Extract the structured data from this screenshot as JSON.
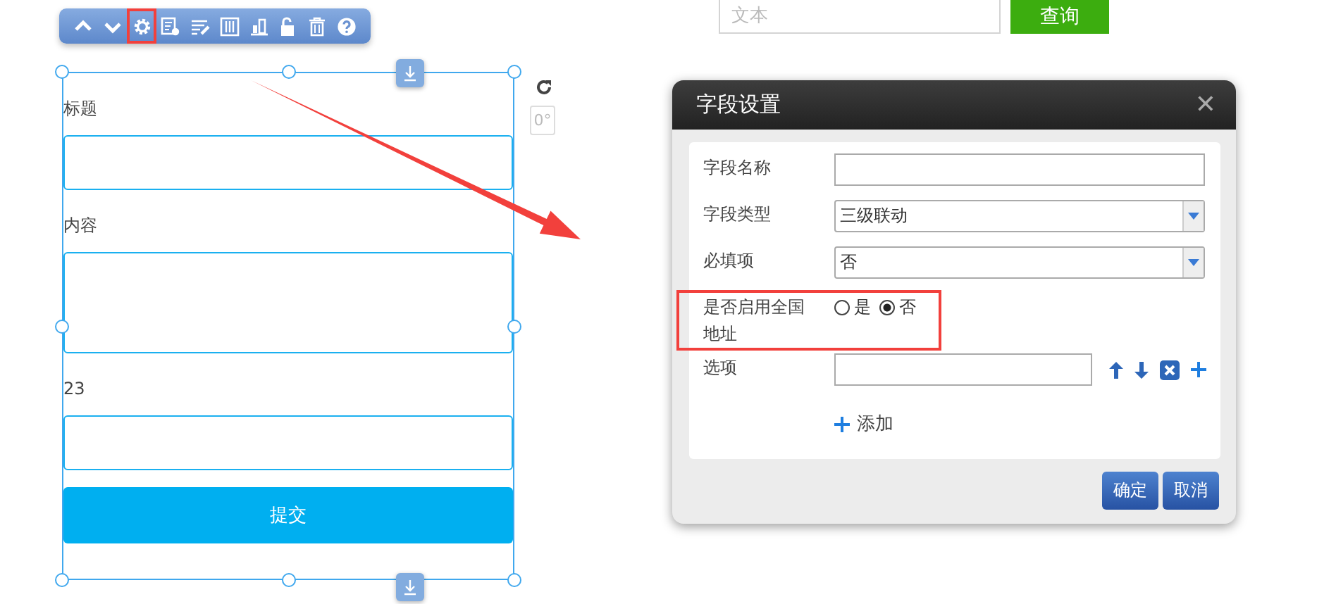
{
  "search": {
    "placeholder": "文本",
    "button": "查询"
  },
  "toolbar": {
    "buttons": [
      {
        "kind": "up",
        "selected": false
      },
      {
        "kind": "down",
        "selected": false
      },
      {
        "kind": "settings",
        "selected": true
      },
      {
        "kind": "list-settings",
        "selected": false
      },
      {
        "kind": "edit",
        "selected": false
      },
      {
        "kind": "columns",
        "selected": false
      },
      {
        "kind": "chart",
        "selected": false
      },
      {
        "kind": "unlock",
        "selected": false
      },
      {
        "kind": "delete",
        "selected": false
      },
      {
        "kind": "help",
        "selected": false
      }
    ]
  },
  "form": {
    "fields": [
      {
        "label": "标题",
        "kind": "input"
      },
      {
        "label": "内容",
        "kind": "textarea"
      },
      {
        "label": "23",
        "kind": "input"
      }
    ],
    "submit": "提交",
    "rotation": "0°"
  },
  "dialog": {
    "title": "字段设置",
    "close": "✕",
    "rows": [
      {
        "kind": "text",
        "label": "字段名称",
        "highlighted": false
      },
      {
        "kind": "select",
        "label": "字段类型",
        "value": "三级联动",
        "highlighted": false
      },
      {
        "kind": "select",
        "label": "必填项",
        "value": "否",
        "highlighted": false
      },
      {
        "kind": "radio",
        "label": "是否启用全国地址",
        "highlighted": true,
        "options": [
          {
            "label": "是",
            "selected": false
          },
          {
            "label": "否",
            "selected": true
          }
        ]
      },
      {
        "kind": "options",
        "label": "选项",
        "highlighted": false
      }
    ],
    "add": "添加",
    "buttons": [
      "确定",
      "取消"
    ]
  }
}
